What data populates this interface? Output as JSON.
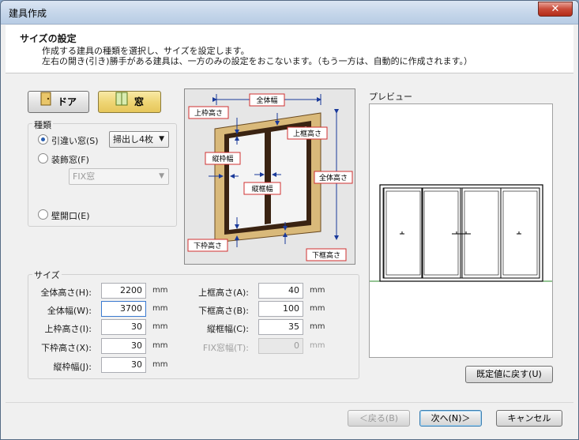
{
  "window": {
    "title": "建具作成",
    "close_glyph": "✕"
  },
  "header": {
    "title": "サイズの設定",
    "line1": "作成する建具の種類を選択し、サイズを設定します。",
    "line2": "左右の開き(引き)勝手がある建具は、一方のみの設定をおこないます。（もう一方は、自動的に作成されます。）"
  },
  "type_buttons": {
    "door": "ドア",
    "window": "窓"
  },
  "kind_group": {
    "label": "種類",
    "options": [
      {
        "label": "引違い窓(S)",
        "checked": true
      },
      {
        "label": "装飾窓(F)",
        "checked": false
      },
      {
        "label": "壁開口(E)",
        "checked": false
      }
    ],
    "sliding_select": "掃出し4枚",
    "decor_select": "FIX窓",
    "arrow_glyph": "▼"
  },
  "diagram_labels": {
    "total_width": "全体幅",
    "total_height": "全体高さ",
    "upper_frame_h": "上枠高さ",
    "upper_rail_h": "上框高さ",
    "side_frame_w": "縦枠幅",
    "stile_w": "縦框幅",
    "lower_frame_h": "下枠高さ",
    "lower_rail_h": "下框高さ"
  },
  "size_group": {
    "label": "サイズ",
    "unit": "mm",
    "left_fields": [
      {
        "label": "全体高さ(H):",
        "value": "2200"
      },
      {
        "label": "全体幅(W):",
        "value": "3700"
      },
      {
        "label": "上枠高さ(I):",
        "value": "30"
      },
      {
        "label": "下枠高さ(X):",
        "value": "30"
      },
      {
        "label": "縦枠幅(J):",
        "value": "30"
      }
    ],
    "right_fields": [
      {
        "label": "上框高さ(A):",
        "value": "40",
        "disabled": false
      },
      {
        "label": "下框高さ(B):",
        "value": "100",
        "disabled": false
      },
      {
        "label": "縦框幅(C):",
        "value": "35",
        "disabled": false
      },
      {
        "label": "FIX窓幅(T):",
        "value": "0",
        "disabled": true
      }
    ]
  },
  "preview": {
    "label": "プレビュー",
    "reset_button": "既定値に戻す(U)"
  },
  "footer": {
    "back": "＜戻る(B)",
    "next": "次へ(N)＞",
    "cancel": "キャンセル"
  }
}
